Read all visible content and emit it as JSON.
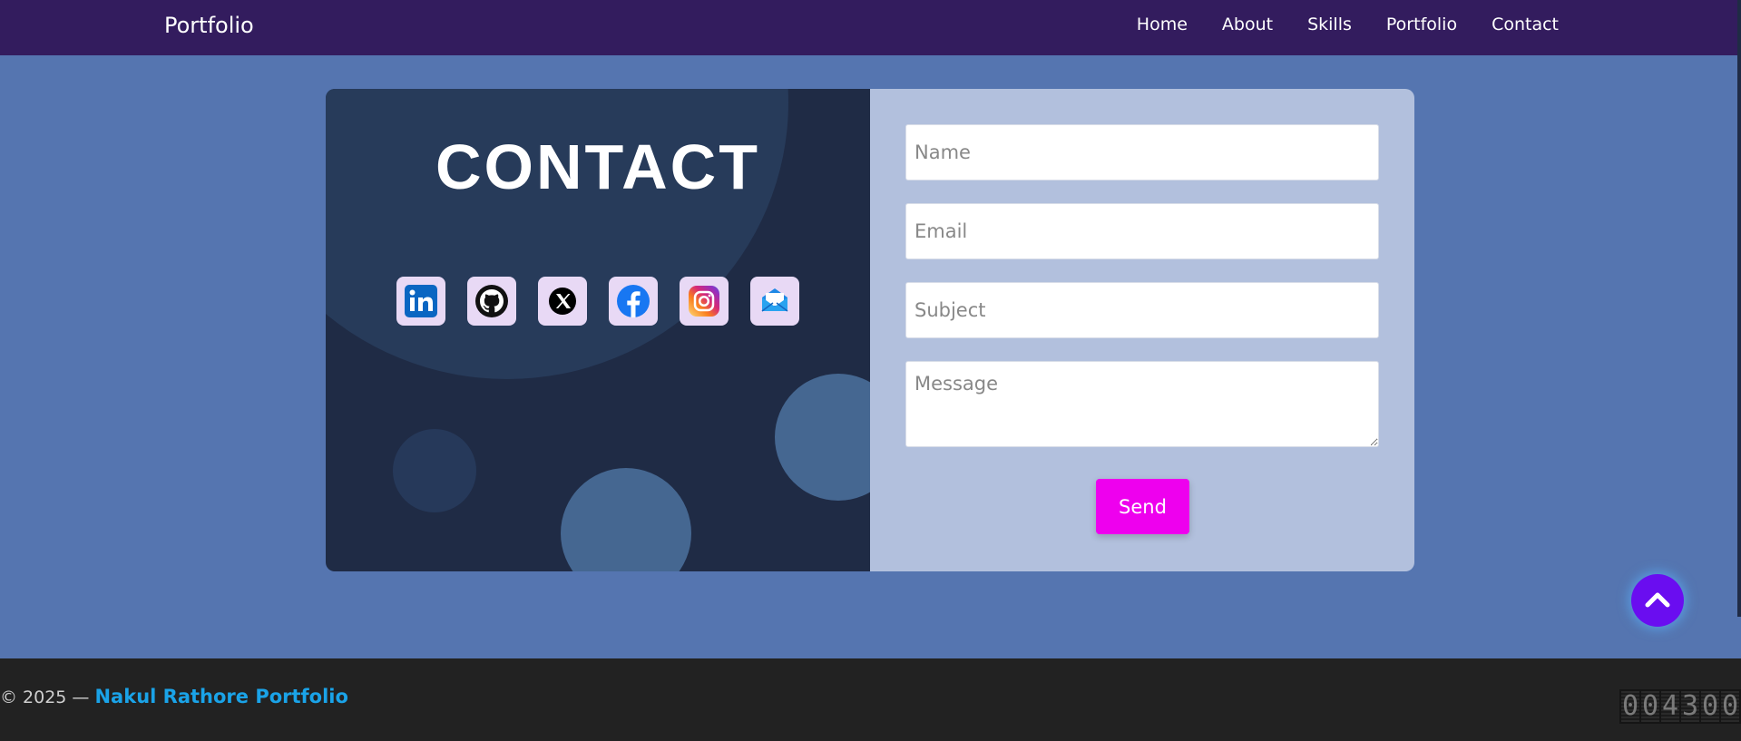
{
  "nav": {
    "brand": "Portfolio",
    "links": [
      "Home",
      "About",
      "Skills",
      "Portfolio",
      "Contact"
    ]
  },
  "contact": {
    "title": "CONTACT",
    "socials": [
      "linkedin-icon",
      "github-icon",
      "x-icon",
      "facebook-icon",
      "instagram-icon",
      "email-icon"
    ]
  },
  "form": {
    "name_placeholder": "Name",
    "email_placeholder": "Email",
    "subject_placeholder": "Subject",
    "message_placeholder": "Message",
    "send_label": "Send"
  },
  "footer": {
    "copyright": "© 2025 — ",
    "owner": "Nakul Rathore Portfolio",
    "counter_digits": [
      "0",
      "0",
      "4",
      "3",
      "0",
      "0"
    ]
  },
  "colors": {
    "nav_bg": "#331c5e",
    "page_bg": "#5575b0",
    "panel_dark": "#1f2b45",
    "panel_light": "#b2c0dd",
    "send_button": "#ee00ee",
    "scroll_button": "#6a0df0",
    "footer_bg": "#222222",
    "owner_link": "#1aa3e8"
  }
}
